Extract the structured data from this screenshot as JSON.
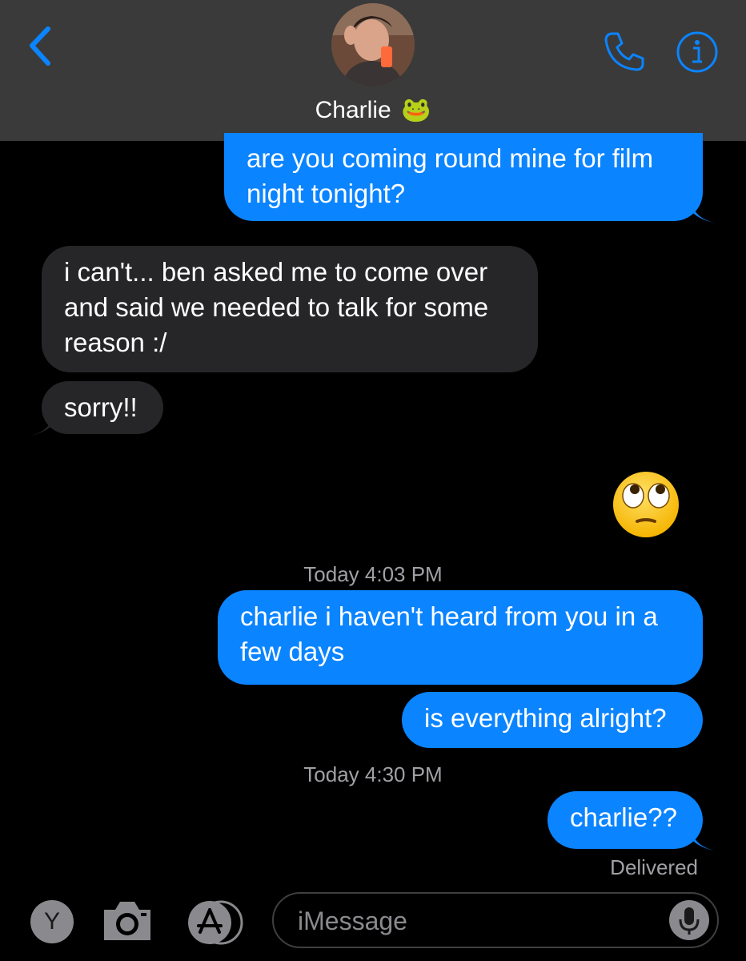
{
  "header": {
    "contact_name": "Charlie",
    "contact_emoji": "🐸"
  },
  "messages": [
    {
      "side": "out",
      "text": "are you coming round mine for film night tonight?"
    },
    {
      "side": "in",
      "text": "i can't... ben asked me to come over and said we needed to talk for some reason  :/"
    },
    {
      "side": "in",
      "text": "sorry!!"
    },
    {
      "side": "out-emoji",
      "emoji": "face-with-rolling-eyes"
    },
    {
      "side": "out",
      "text": "charlie i haven't heard from you in a few days"
    },
    {
      "side": "out",
      "text": "is everything alright?"
    },
    {
      "side": "out",
      "text": "charlie??"
    }
  ],
  "timestamps": [
    "Today 4:03 PM",
    "Today 4:30 PM"
  ],
  "status": "Delivered",
  "compose": {
    "placeholder": "iMessage",
    "y_button_label": "Y"
  },
  "colors": {
    "accent": "#0b84ff",
    "incoming": "#262628",
    "header_bg": "#3a3a3a",
    "background": "#000000"
  },
  "icons": [
    "back-chevron-icon",
    "phone-icon",
    "info-icon",
    "camera-icon",
    "app-store-icon",
    "microphone-icon"
  ]
}
